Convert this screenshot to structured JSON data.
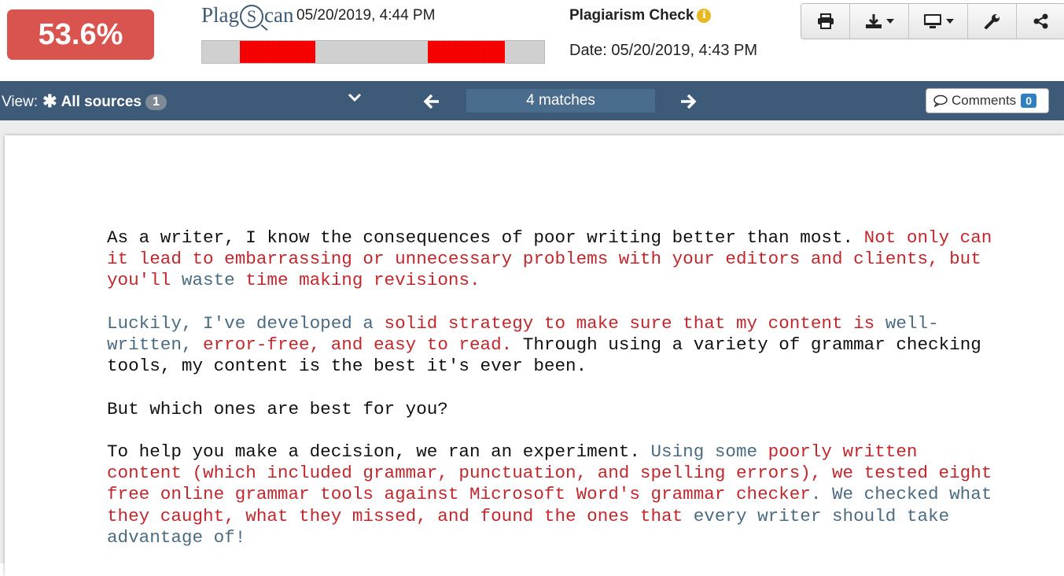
{
  "header": {
    "score": "53.6%",
    "logo": {
      "part1": "Plag",
      "part2": "S",
      "part3": "can"
    },
    "upload_date": "05/20/2019, 4:44 PM",
    "match_bar": {
      "segments": [
        {
          "start": 0.11,
          "end": 0.33
        },
        {
          "start": 0.66,
          "end": 0.885
        }
      ],
      "color": "#ff0000"
    },
    "check_title": "Plagiarism Check",
    "check_date": "Date: 05/20/2019, 4:43 PM",
    "toolbar": [
      {
        "name": "print-button",
        "icon": "printer-icon"
      },
      {
        "name": "download-button",
        "icon": "download-icon"
      },
      {
        "name": "display-button",
        "icon": "monitor-icon"
      },
      {
        "name": "settings-button",
        "icon": "wrench-icon"
      },
      {
        "name": "share-button",
        "icon": "share-icon"
      }
    ]
  },
  "navbar": {
    "view_label": "View:",
    "view_value": "All sources",
    "view_count": "1",
    "matches": "4 matches",
    "comments_label": "Comments",
    "comments_count": "0"
  },
  "document": {
    "paragraphs": [
      {
        "lines": [
          [
            {
              "t": "As a writer, I know the consequences of poor writing better than most. ",
              "c": "n"
            },
            {
              "t": "Not only can",
              "c": "r"
            }
          ],
          [
            {
              "t": "it lead to embarrassing or unnecessary problems with your editors and clients, but",
              "c": "r"
            }
          ],
          [
            {
              "t": "you'll ",
              "c": "r"
            },
            {
              "t": "waste",
              "c": "b"
            },
            {
              "t": " time making revisions.",
              "c": "r"
            }
          ]
        ]
      },
      {
        "lines": [
          [
            {
              "t": "Luckily, I've developed a ",
              "c": "b"
            },
            {
              "t": "solid strategy to make sure that my content is ",
              "c": "r"
            },
            {
              "t": "well-",
              "c": "b"
            }
          ],
          [
            {
              "t": "written, ",
              "c": "b"
            },
            {
              "t": "error-free, and easy to read.",
              "c": "r"
            },
            {
              "t": " Through using a variety of grammar checking",
              "c": "n"
            }
          ],
          [
            {
              "t": "tools, my content is the best it's ever been.",
              "c": "n"
            }
          ]
        ]
      },
      {
        "lines": [
          [
            {
              "t": "But which ones are best for you?",
              "c": "n"
            }
          ]
        ]
      },
      {
        "lines": [
          [
            {
              "t": "To help you make a decision, we ran an experiment. ",
              "c": "n"
            },
            {
              "t": "Using some",
              "c": "b"
            },
            {
              "t": " poorly written",
              "c": "r"
            }
          ],
          [
            {
              "t": "content (which included grammar, punctuation, and spelling errors), we tested eight",
              "c": "r"
            }
          ],
          [
            {
              "t": "free online grammar tools against Microsoft Word's grammar checker",
              "c": "r"
            },
            {
              "t": ". We checked what",
              "c": "b"
            }
          ],
          [
            {
              "t": "they caught, what they missed, and found the ones that ",
              "c": "r"
            },
            {
              "t": "every writer should take",
              "c": "b"
            }
          ],
          [
            {
              "t": "advantage of!",
              "c": "b"
            }
          ]
        ]
      }
    ]
  }
}
